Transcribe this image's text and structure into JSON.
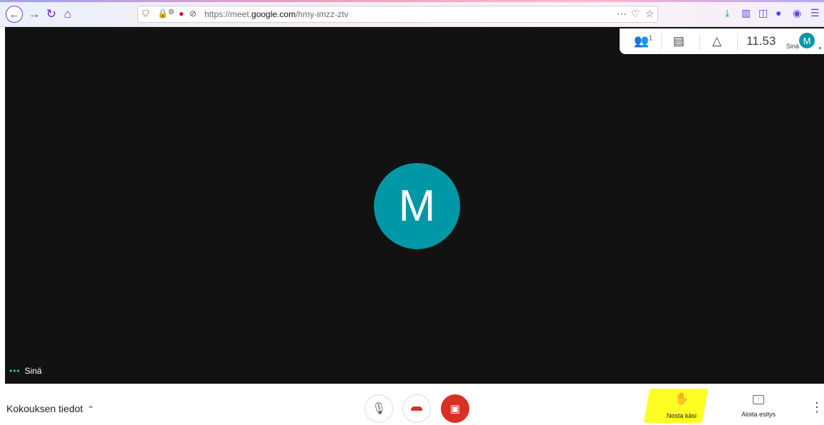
{
  "browser": {
    "url_prefix": "https://meet.",
    "url_domain": "google.com",
    "url_path": "/hmy-imzz-ztv",
    "icons": {
      "back": "back-arrow-icon",
      "forward": "forward-arrow-icon",
      "reload": "reload-icon",
      "home": "home-icon"
    }
  },
  "top_panel": {
    "participants_count": "1",
    "clock": "11.53",
    "me_label": "Sinä",
    "me_initial": "M"
  },
  "stage": {
    "avatar_initial": "M",
    "self_label": "Sinä",
    "dots": "•••"
  },
  "bottom": {
    "meeting_info_label": "Kokouksen tiedot",
    "raise_hand_label": "Nosta käsi",
    "present_label": "Aloita esitys"
  },
  "colors": {
    "accent": "#0097a7",
    "danger": "#d93025",
    "highlight": "#ffff24",
    "stage_bg": "#121212"
  }
}
